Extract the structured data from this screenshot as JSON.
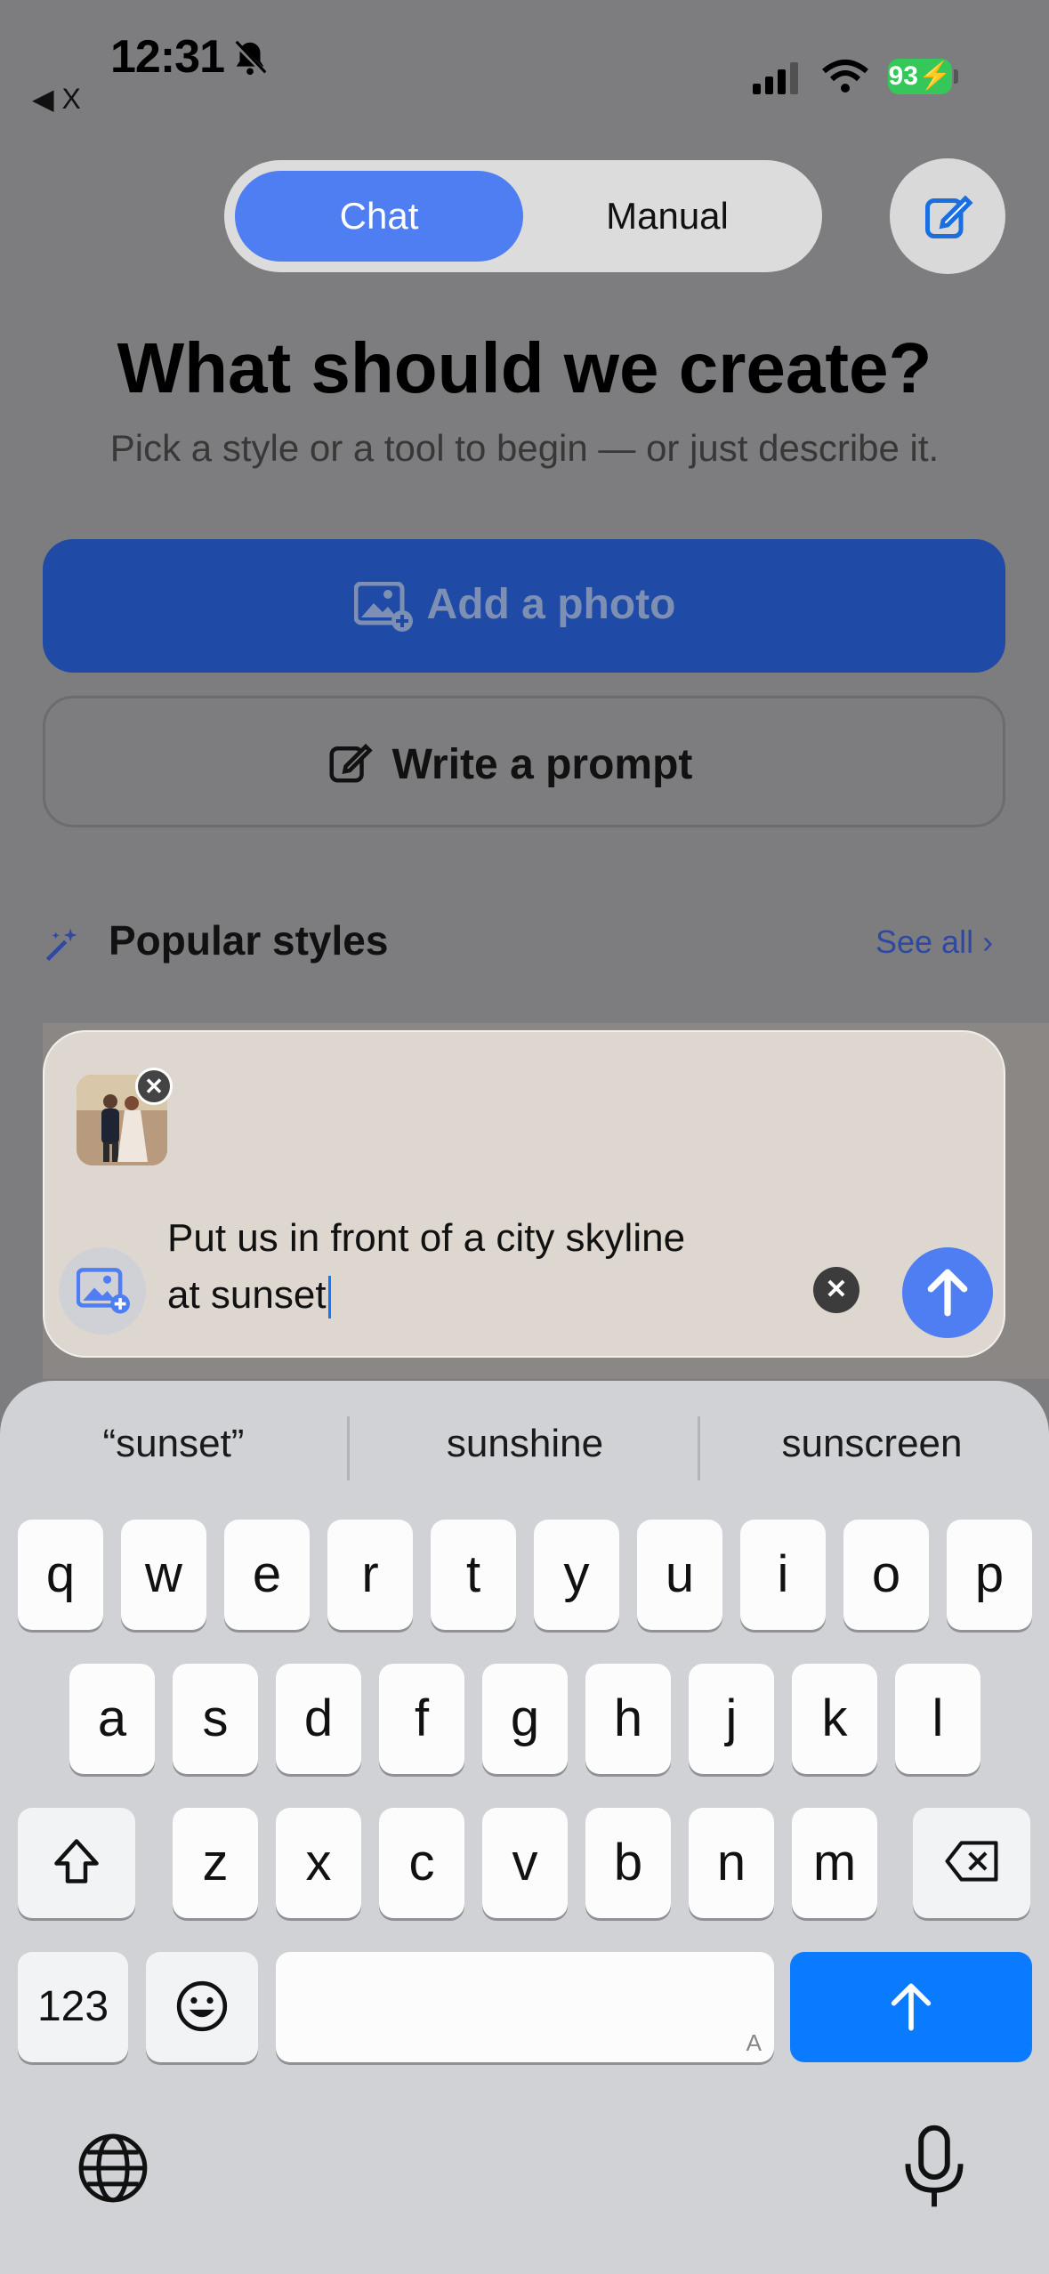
{
  "status_bar": {
    "time": "12:31",
    "back_label": "◀ X",
    "battery": "93"
  },
  "segmented": {
    "chat_label": "Chat",
    "manual_label": "Manual"
  },
  "header": {
    "title": "What should we create?",
    "subtitle": "Pick a style or a tool to begin — or just describe it."
  },
  "actions": {
    "add_photo_label": "Add a photo",
    "write_prompt_label": "Write a prompt"
  },
  "popular": {
    "title": "Popular styles",
    "see_all_label": "See all"
  },
  "composer": {
    "line1": "Put us in front of a city skyline",
    "line2": "at sunset"
  },
  "keyboard": {
    "suggestions": [
      "“sunset”",
      "sunshine",
      "sunscreen"
    ],
    "row1": [
      "q",
      "w",
      "e",
      "r",
      "t",
      "y",
      "u",
      "i",
      "o",
      "p"
    ],
    "row2": [
      "a",
      "s",
      "d",
      "f",
      "g",
      "h",
      "j",
      "k",
      "l"
    ],
    "row3": [
      "z",
      "x",
      "c",
      "v",
      "b",
      "n",
      "m"
    ],
    "numbers_label": "123",
    "space_hint": "A"
  },
  "colors": {
    "accent": "#4f7ef2",
    "primary_button": "#1f4aa6",
    "return_key": "#0a7aff",
    "battery": "#35c759"
  }
}
